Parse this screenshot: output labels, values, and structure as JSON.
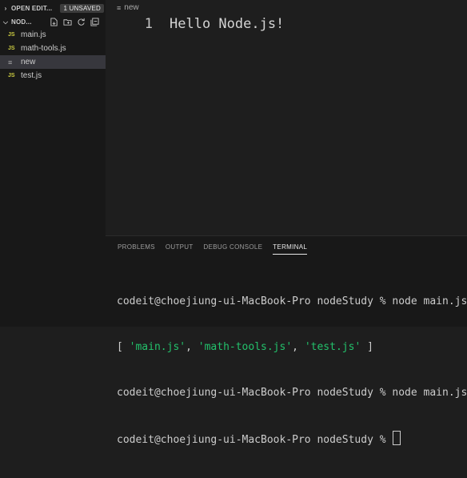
{
  "sidebar": {
    "open_editors_label": "OPEN EDIT...",
    "unsaved_badge": "1 UNSAVED",
    "folder_label": "NOD...",
    "files": [
      {
        "icon": "JS",
        "name": "main.js"
      },
      {
        "icon": "JS",
        "name": "math-tools.js"
      },
      {
        "icon": "≡",
        "name": "new"
      },
      {
        "icon": "JS",
        "name": "test.js"
      }
    ]
  },
  "editor": {
    "breadcrumb": "new",
    "line_number": "1",
    "code": "Hello Node.js!"
  },
  "panel": {
    "tabs": [
      "PROBLEMS",
      "OUTPUT",
      "DEBUG CONSOLE",
      "TERMINAL"
    ],
    "active_tab": "TERMINAL",
    "terminal": {
      "line1": "codeit@choejiung-ui-MacBook-Pro nodeStudy % node main.js",
      "line2_open": "[ ",
      "line2_items": [
        "'main.js'",
        "'math-tools.js'",
        "'test.js'"
      ],
      "line2_sep": ", ",
      "line2_close": " ]",
      "line3": "codeit@choejiung-ui-MacBook-Pro nodeStudy % node main.js",
      "line4": "codeit@choejiung-ui-MacBook-Pro nodeStudy % "
    }
  },
  "colors": {
    "js_icon": "#cbcb41",
    "terminal_string": "#23c16b"
  }
}
